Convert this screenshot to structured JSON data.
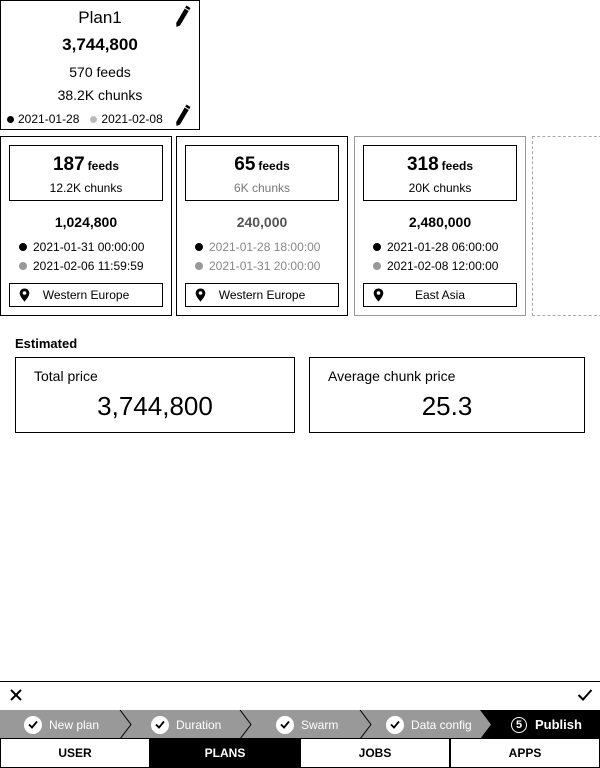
{
  "plan": {
    "name": "Plan1",
    "total": "3,744,800",
    "feeds": "570 feeds",
    "chunks": "38.2K chunks",
    "start_date": "2021-01-28",
    "end_date": "2021-02-08"
  },
  "swarms": [
    {
      "feeds_count": "187",
      "feeds_word": "feeds",
      "chunks": "12.2K chunks",
      "amount": "1,024,800",
      "start": "2021-01-31 00:00:00",
      "end": "2021-02-06 11:59:59",
      "region": "Western Europe"
    },
    {
      "feeds_count": "65",
      "feeds_word": "feeds",
      "chunks": "6K chunks",
      "amount": "240,000",
      "start": "2021-01-28 18:00:00",
      "end": "2021-01-31 20:00:00",
      "region": "Western Europe"
    },
    {
      "feeds_count": "318",
      "feeds_word": "feeds",
      "chunks": "20K chunks",
      "amount": "2,480,000",
      "start": "2021-01-28 06:00:00",
      "end": "2021-02-08 12:00:00",
      "region": "East Asia"
    }
  ],
  "estimated": {
    "title": "Estimated",
    "total_label": "Total price",
    "total_value": "3,744,800",
    "avg_label": "Average chunk price",
    "avg_value": "25.3"
  },
  "stepper": {
    "steps": [
      {
        "label": "New plan"
      },
      {
        "label": "Duration"
      },
      {
        "label": "Swarm"
      },
      {
        "label": "Data config"
      },
      {
        "label": "Publish",
        "number": "5"
      }
    ]
  },
  "nav": {
    "tabs": [
      {
        "label": "USER"
      },
      {
        "label": "PLANS"
      },
      {
        "label": "JOBS"
      },
      {
        "label": "APPS"
      }
    ]
  },
  "icons": {
    "edit": "pencil-icon",
    "location": "map-pin-icon",
    "close": "close-icon",
    "confirm": "checkmark-icon",
    "step_done": "check-circle-icon"
  },
  "colors": {
    "active": "#000000",
    "stepper_bg": "#999999",
    "muted_dot": "#bbbbbb"
  }
}
